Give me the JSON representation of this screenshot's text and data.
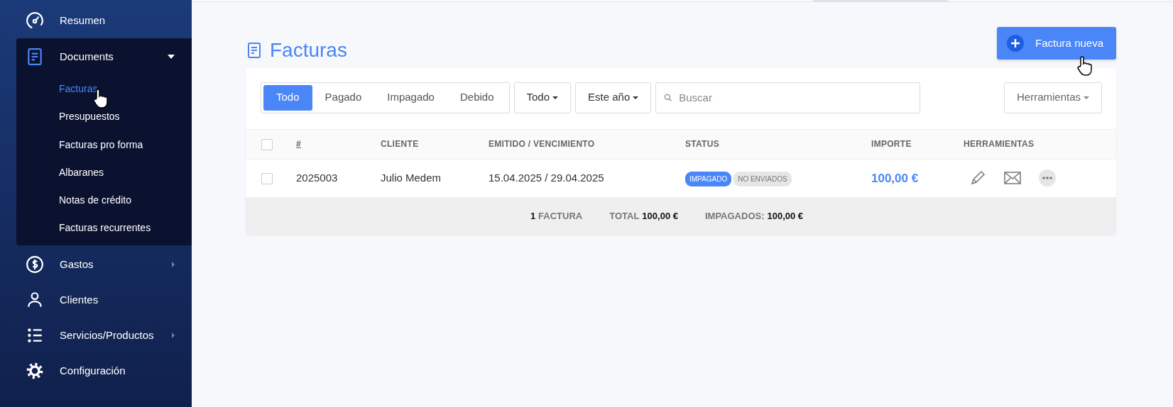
{
  "sidebar": {
    "items": [
      {
        "label": "Resumen"
      },
      {
        "label": "Documents",
        "expanded": true,
        "children": [
          {
            "label": "Facturas",
            "selected": true
          },
          {
            "label": "Presupuestos",
            "selected": false
          },
          {
            "label": "Facturas pro forma",
            "selected": false
          },
          {
            "label": "Albaranes",
            "selected": false
          },
          {
            "label": "Notas de crédito",
            "selected": false
          },
          {
            "label": "Facturas recurrentes",
            "selected": false
          }
        ]
      },
      {
        "label": "Gastos",
        "expanded": false
      },
      {
        "label": "Clientes"
      },
      {
        "label": "Servicios/Productos",
        "expanded": false
      },
      {
        "label": "Configuración"
      }
    ]
  },
  "page": {
    "title": "Facturas",
    "new_button": "Factura nueva"
  },
  "filters": {
    "tabs": [
      {
        "label": "Todo",
        "selected": true
      },
      {
        "label": "Pagado",
        "selected": false
      },
      {
        "label": "Impagado",
        "selected": false
      },
      {
        "label": "Debido",
        "selected": false
      }
    ],
    "dropdowns": [
      "Todo",
      "Este año"
    ],
    "search": {
      "placeholder": "Buscar"
    },
    "tools": "Herramientas"
  },
  "table": {
    "select_all": {
      "checked": false
    },
    "columns": [
      "#",
      "CLIENTE",
      "EMITIDO / VENCIMIENTO",
      "STATUS",
      "IMPORTE",
      "HERRAMIENTAS"
    ],
    "rows": [
      {
        "checked": false,
        "number": "2025003",
        "client": "Julio Medem",
        "dates": "15.04.2025 / 29.04.2025",
        "badges": [
          {
            "label": "IMPAGADO",
            "kind": "primary"
          },
          {
            "label": "NO ENVIADOS",
            "kind": "muted"
          }
        ],
        "amount": "100,00 €"
      }
    ],
    "footer": [
      {
        "value": "1",
        "label": "FACTURA"
      },
      {
        "label": "TOTAL",
        "value": "100,00 €"
      },
      {
        "label": "IMPAGADOS:",
        "value": "100,00 €"
      }
    ]
  }
}
